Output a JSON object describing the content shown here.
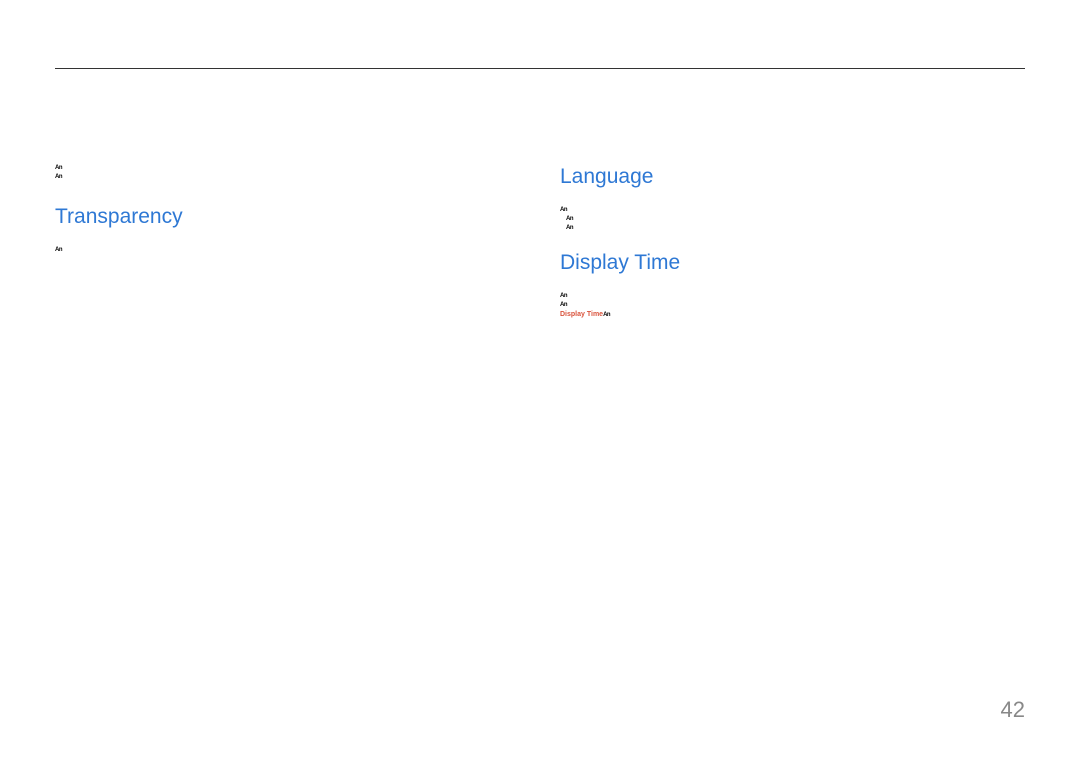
{
  "left": {
    "intro_lines": [
      "An",
      "An"
    ],
    "heading1": "Transparency",
    "sec1_lines": [
      "An"
    ]
  },
  "right": {
    "heading1": "Language",
    "sec1_lines": [
      "An",
      "An",
      "An"
    ],
    "heading2": "Display Time",
    "sec2_lines": [
      "An",
      "An"
    ],
    "highlight_label": "Display Time",
    "highlight_suffix": "An"
  },
  "page_number": "42"
}
